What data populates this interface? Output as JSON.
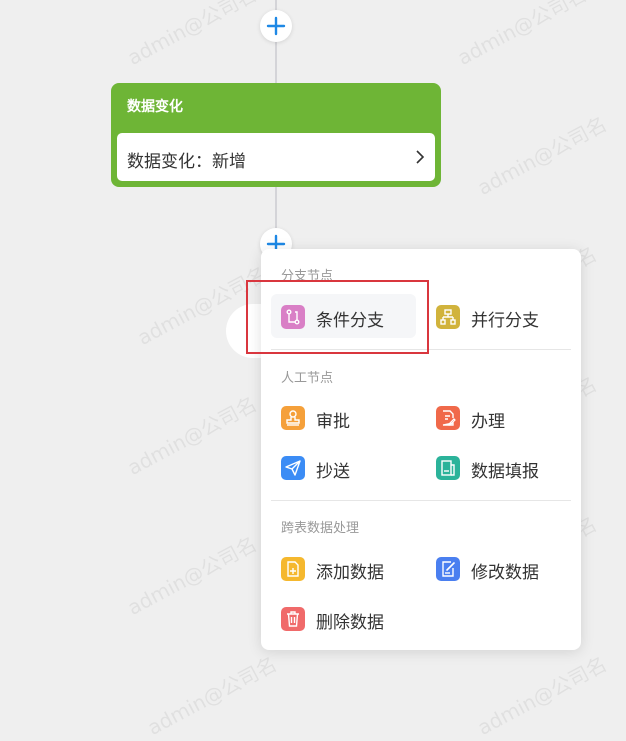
{
  "watermark": "admin@公司名",
  "node": {
    "title": "数据变化",
    "body": "数据变化：新增",
    "color": "#6eb536"
  },
  "menu": {
    "sections": [
      {
        "title": "分支节点",
        "items": [
          {
            "label": "条件分支",
            "icon": "branch-icon",
            "color": "#d97fc6"
          },
          {
            "label": "并行分支",
            "icon": "parallel-icon",
            "color": "#d1b33c"
          }
        ]
      },
      {
        "title": "人工节点",
        "items": [
          {
            "label": "审批",
            "icon": "stamp-icon",
            "color": "#f5a03a"
          },
          {
            "label": "办理",
            "icon": "edit-doc-icon",
            "color": "#f0694a"
          },
          {
            "label": "抄送",
            "icon": "send-icon",
            "color": "#3b8cf5"
          },
          {
            "label": "数据填报",
            "icon": "form-icon",
            "color": "#2bb39a"
          }
        ]
      },
      {
        "title": "跨表数据处理",
        "items": [
          {
            "label": "添加数据",
            "icon": "add-doc-icon",
            "color": "#f5b82e"
          },
          {
            "label": "修改数据",
            "icon": "modify-doc-icon",
            "color": "#4a7ff0"
          },
          {
            "label": "删除数据",
            "icon": "trash-icon",
            "color": "#f06a6a"
          }
        ]
      }
    ]
  },
  "colors": {
    "plus": "#1e88e5",
    "highlight": "#d9363e"
  }
}
